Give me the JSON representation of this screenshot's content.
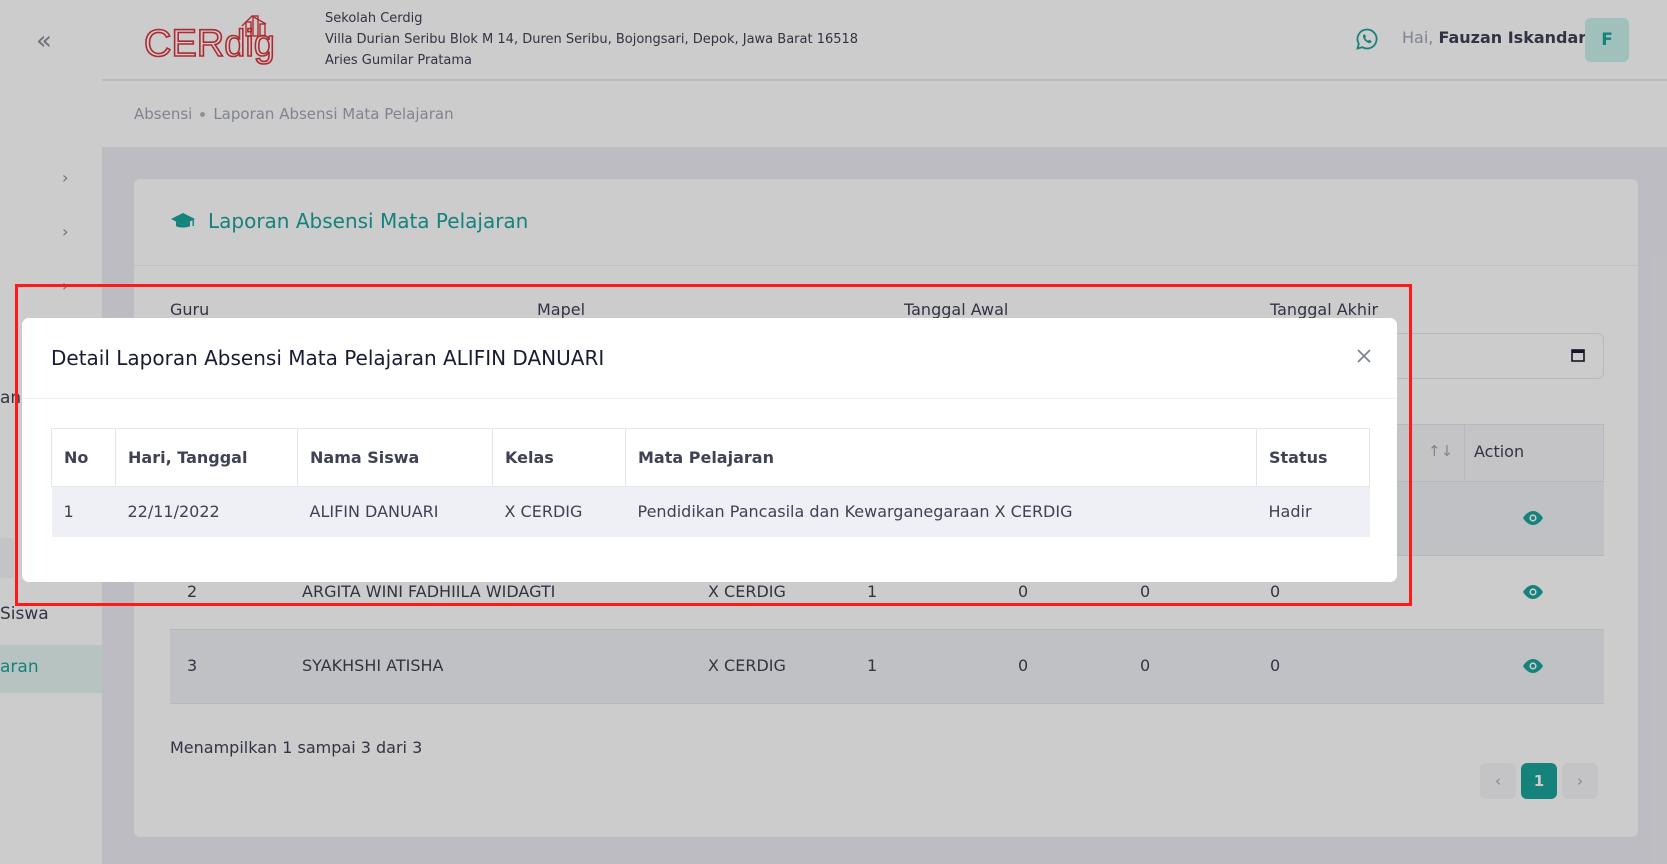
{
  "sidebar": {
    "item_left": "an",
    "item_siswa": "Siswa",
    "item_active": "aran"
  },
  "header": {
    "school_name": "Sekolah Cerdig",
    "school_address": "Villa Durian Seribu Blok M 14, Duren Seribu, Bojongsari, Depok, Jawa Barat 16518",
    "school_head": "Aries Gumilar Pratama",
    "greeting_prefix": "Hai,",
    "user_name": "Fauzan Iskandar",
    "avatar_initial": "F",
    "logo_text": "CERdig"
  },
  "breadcrumb": {
    "root": "Absensi",
    "current": "Laporan Absensi Mata Pelajaran"
  },
  "card": {
    "title": "Laporan Absensi Mata Pelajaran",
    "filters": {
      "guru": "Guru",
      "mapel": "Mapel",
      "tanggal_awal": "Tanggal Awal",
      "tanggal_akhir": "Tanggal Akhir"
    },
    "action_header": "Action",
    "rows": [
      {
        "no": "",
        "nama": "",
        "kelas": "",
        "c1": "",
        "c2": "",
        "c3": "",
        "c4": ""
      },
      {
        "no": "2",
        "nama": "ARGITA WINI FADHIILA WIDAGTI",
        "kelas": "X CERDIG",
        "c1": "1",
        "c2": "0",
        "c3": "0",
        "c4": "0"
      },
      {
        "no": "3",
        "nama": "SYAKHSHI ATISHA",
        "kelas": "X CERDIG",
        "c1": "1",
        "c2": "0",
        "c3": "0",
        "c4": "0"
      }
    ],
    "showing": "Menampilkan 1 sampai 3 dari 3",
    "pagination": {
      "current": "1"
    }
  },
  "modal": {
    "title": "Detail Laporan Absensi Mata Pelajaran ALIFIN DANUARI",
    "columns": [
      "No",
      "Hari, Tanggal",
      "Nama Siswa",
      "Kelas",
      "Mata Pelajaran",
      "Status"
    ],
    "rows": [
      {
        "no": "1",
        "tanggal": "22/11/2022",
        "nama": "ALIFIN DANUARI",
        "kelas": "X CERDIG",
        "mapel": "Pendidikan Pancasila dan Kewarganegaraan X CERDIG",
        "status": "Hadir"
      }
    ]
  },
  "colors": {
    "accent": "#1ba39c",
    "highlight": "#ff1a1a",
    "logo": "#d9363e"
  }
}
